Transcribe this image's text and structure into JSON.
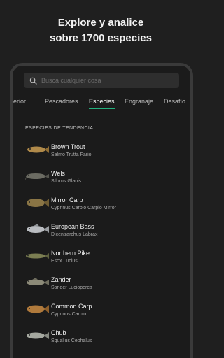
{
  "headline": {
    "line1": "Explore y analice",
    "line2": "sobre 1700 especies"
  },
  "search": {
    "placeholder": "Busca cualquier cosa"
  },
  "tabs": [
    {
      "label": "perior"
    },
    {
      "label": "Pescadores"
    },
    {
      "label": "Especies"
    },
    {
      "label": "Engranaje"
    },
    {
      "label": "Desafío"
    }
  ],
  "active_tab": "Especies",
  "section": {
    "title": "ESPECIES DE TENDENCIA"
  },
  "species": [
    {
      "name": "Brown Trout",
      "latin": "Salmo Trutta Fario",
      "color": "#b08a4a"
    },
    {
      "name": "Wels",
      "latin": "Silurus Glanis",
      "color": "#6b6b62"
    },
    {
      "name": "Mirror Carp",
      "latin": "Cyprinus Carpio Carpio Mirror",
      "color": "#8a7545"
    },
    {
      "name": "European Bass",
      "latin": "Dicentrarchus Labrax",
      "color": "#b9bcc0"
    },
    {
      "name": "Northern Pike",
      "latin": "Esox Lucius",
      "color": "#7b7e52"
    },
    {
      "name": "Zander",
      "latin": "Sander Lucioperca",
      "color": "#8c8a78"
    },
    {
      "name": "Common Carp",
      "latin": "Cyprinus Carpio",
      "color": "#b07a3c"
    },
    {
      "name": "Chub",
      "latin": "Squalius Cephalus",
      "color": "#a5a8a0"
    }
  ],
  "colors": {
    "accent": "#22b07d",
    "background": "#1b1b1b"
  },
  "nav": [
    "catalog-icon",
    "search-icon",
    "add-icon",
    "profile-icon",
    "menu-icon"
  ]
}
